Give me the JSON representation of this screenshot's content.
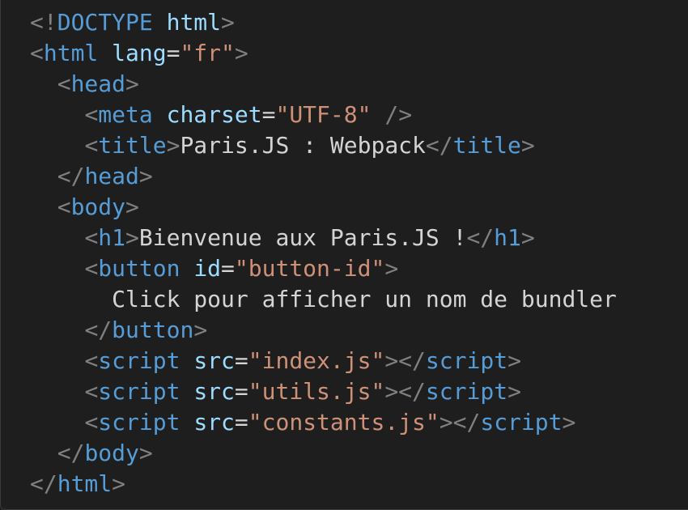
{
  "code": {
    "language": "html",
    "lines": [
      {
        "indent": 0,
        "tokens": [
          [
            "p",
            "<!"
          ],
          [
            "t",
            "DOCTYPE"
          ],
          [
            "x",
            " "
          ],
          [
            "a",
            "html"
          ],
          [
            "p",
            ">"
          ]
        ]
      },
      {
        "indent": 0,
        "tokens": [
          [
            "p",
            "<"
          ],
          [
            "t",
            "html"
          ],
          [
            "x",
            " "
          ],
          [
            "a",
            "lang"
          ],
          [
            "x",
            "="
          ],
          [
            "s",
            "\"fr\""
          ],
          [
            "p",
            ">"
          ]
        ]
      },
      {
        "indent": 1,
        "tokens": [
          [
            "p",
            "<"
          ],
          [
            "t",
            "head"
          ],
          [
            "p",
            ">"
          ]
        ]
      },
      {
        "indent": 2,
        "tokens": [
          [
            "p",
            "<"
          ],
          [
            "t",
            "meta"
          ],
          [
            "x",
            " "
          ],
          [
            "a",
            "charset"
          ],
          [
            "x",
            "="
          ],
          [
            "s",
            "\"UTF-8\""
          ],
          [
            "x",
            " "
          ],
          [
            "p",
            "/>"
          ]
        ]
      },
      {
        "indent": 2,
        "tokens": [
          [
            "p",
            "<"
          ],
          [
            "t",
            "title"
          ],
          [
            "p",
            ">"
          ],
          [
            "x",
            "Paris.JS : Webpack"
          ],
          [
            "p",
            "</"
          ],
          [
            "t",
            "title"
          ],
          [
            "p",
            ">"
          ]
        ]
      },
      {
        "indent": 1,
        "tokens": [
          [
            "p",
            "</"
          ],
          [
            "t",
            "head"
          ],
          [
            "p",
            ">"
          ]
        ]
      },
      {
        "indent": 1,
        "tokens": [
          [
            "p",
            "<"
          ],
          [
            "t",
            "body"
          ],
          [
            "p",
            ">"
          ]
        ]
      },
      {
        "indent": 2,
        "tokens": [
          [
            "p",
            "<"
          ],
          [
            "t",
            "h1"
          ],
          [
            "p",
            ">"
          ],
          [
            "x",
            "Bienvenue aux Paris.JS !"
          ],
          [
            "p",
            "</"
          ],
          [
            "t",
            "h1"
          ],
          [
            "p",
            ">"
          ]
        ]
      },
      {
        "indent": 2,
        "tokens": [
          [
            "p",
            "<"
          ],
          [
            "t",
            "button"
          ],
          [
            "x",
            " "
          ],
          [
            "a",
            "id"
          ],
          [
            "x",
            "="
          ],
          [
            "s",
            "\"button-id\""
          ],
          [
            "p",
            ">"
          ]
        ]
      },
      {
        "indent": 3,
        "tokens": [
          [
            "x",
            "Click pour afficher un nom de bundler"
          ]
        ]
      },
      {
        "indent": 2,
        "tokens": [
          [
            "p",
            "</"
          ],
          [
            "t",
            "button"
          ],
          [
            "p",
            ">"
          ]
        ]
      },
      {
        "indent": 2,
        "tokens": [
          [
            "p",
            "<"
          ],
          [
            "t",
            "script"
          ],
          [
            "x",
            " "
          ],
          [
            "a",
            "src"
          ],
          [
            "x",
            "="
          ],
          [
            "s",
            "\"index.js\""
          ],
          [
            "p",
            "></"
          ],
          [
            "t",
            "script"
          ],
          [
            "p",
            ">"
          ]
        ]
      },
      {
        "indent": 2,
        "tokens": [
          [
            "p",
            "<"
          ],
          [
            "t",
            "script"
          ],
          [
            "x",
            " "
          ],
          [
            "a",
            "src"
          ],
          [
            "x",
            "="
          ],
          [
            "s",
            "\"utils.js\""
          ],
          [
            "p",
            "></"
          ],
          [
            "t",
            "script"
          ],
          [
            "p",
            ">"
          ]
        ]
      },
      {
        "indent": 2,
        "tokens": [
          [
            "p",
            "<"
          ],
          [
            "t",
            "script"
          ],
          [
            "x",
            " "
          ],
          [
            "a",
            "src"
          ],
          [
            "x",
            "="
          ],
          [
            "s",
            "\"constants.js\""
          ],
          [
            "p",
            "></"
          ],
          [
            "t",
            "script"
          ],
          [
            "p",
            ">"
          ]
        ]
      },
      {
        "indent": 1,
        "tokens": [
          [
            "p",
            "</"
          ],
          [
            "t",
            "body"
          ],
          [
            "p",
            ">"
          ]
        ]
      },
      {
        "indent": 0,
        "tokens": [
          [
            "p",
            "</"
          ],
          [
            "t",
            "html"
          ],
          [
            "p",
            ">"
          ]
        ]
      }
    ]
  },
  "colors": {
    "background": "#1e1e1e",
    "punctuation": "#808080",
    "tag": "#569cd6",
    "attribute": "#9cdcfe",
    "string": "#ce9178",
    "text": "#d4d4d4"
  }
}
